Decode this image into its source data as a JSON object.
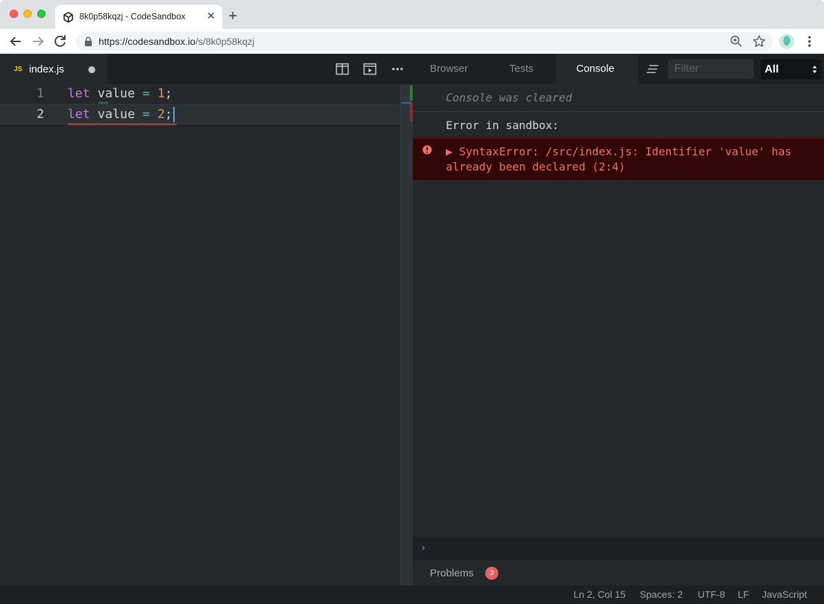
{
  "browser": {
    "tab_title": "8k0p58kqzj - CodeSandbox",
    "tab_close": "✕",
    "new_tab": "+",
    "url_host": "https://codesandbox.io",
    "url_path": "/s/8k0p58kqzj"
  },
  "editor": {
    "file_badge": "JS",
    "file_name": "index.js",
    "lines": [
      {
        "number": "1",
        "keyword": "let",
        "identifier": "value",
        "operator": "=",
        "value": "1",
        "end": ";"
      },
      {
        "number": "2",
        "keyword": "let",
        "identifier": "value",
        "operator": "=",
        "value": "2",
        "end": ";"
      }
    ]
  },
  "panel": {
    "tabs": [
      "Browser",
      "Tests",
      "Console"
    ],
    "active_tab": "Console",
    "filter_placeholder": "Filter",
    "level_select": "All"
  },
  "console": {
    "cleared": "Console was cleared",
    "error_label": "Error in sandbox:",
    "error_message": "▶ SyntaxError: /src/index.js: Identifier 'value' has already been declared (2:4)",
    "prompt": "›"
  },
  "problems": {
    "label": "Problems",
    "count": "3"
  },
  "status_bar": {
    "position": "Ln 2, Col 15",
    "spaces": "Spaces: 2",
    "encoding": "UTF-8",
    "eol": "LF",
    "language": "JavaScript"
  },
  "colors": {
    "keyword": "#c678dd",
    "operator": "#56b6c2",
    "number": "#d19a66",
    "error_text": "#f07171",
    "error_bg": "#320707",
    "badge": "#e86060"
  }
}
